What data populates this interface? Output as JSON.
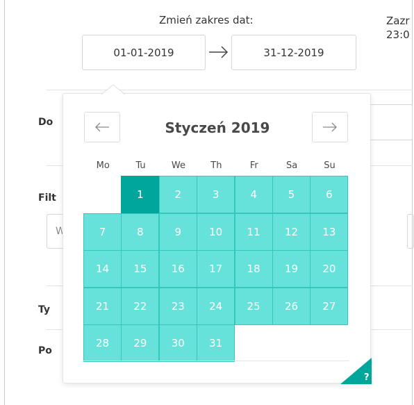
{
  "range": {
    "label": "Zmień zakres dat:",
    "start_date": "01-01-2019",
    "end_date": "31-12-2019"
  },
  "right_clip": {
    "line1": "Zazr",
    "line2": "23:0"
  },
  "background": {
    "labels": [
      "Do",
      "Filt",
      "Ty",
      "Po"
    ],
    "input_placeholder": "W"
  },
  "calendar": {
    "month_title": "Styczeń 2019",
    "weekdays": [
      "Mo",
      "Tu",
      "We",
      "Th",
      "Fr",
      "Sa",
      "Su"
    ],
    "first_weekday_index": 1,
    "days": [
      "1",
      "2",
      "3",
      "4",
      "5",
      "6",
      "7",
      "8",
      "9",
      "10",
      "11",
      "12",
      "13",
      "14",
      "15",
      "16",
      "17",
      "18",
      "19",
      "20",
      "21",
      "22",
      "23",
      "24",
      "25",
      "26",
      "27",
      "28",
      "29",
      "30",
      "31"
    ],
    "selected_day": "1",
    "help": "?"
  },
  "colors": {
    "in_range": "#66e2da",
    "in_range_border": "#33c8bb",
    "selected": "#00a699"
  },
  "icons": {
    "prev": "left-arrow-icon",
    "next": "right-arrow-icon",
    "range": "right-arrow-icon"
  }
}
